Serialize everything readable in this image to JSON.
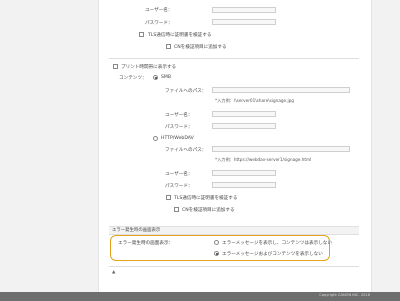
{
  "auth_top": {
    "username_label": "ユーザー名：",
    "password_label": "パスワード：",
    "tls_verify_label": "TLS通信時に証明書を検証する",
    "cn_add_label": "CNを検証項目に追加する"
  },
  "print_job_section": {
    "title": "プリント時間帯に表示する",
    "content_label": "コンテンツ：",
    "smb_label": "SMB",
    "file_path_label": "ファイルへのパス：",
    "smb_example": "*入力例：\\\\server01\\share\\signage.jpg",
    "username_label": "ユーザー名：",
    "password_label": "パスワード：",
    "http_label": "HTTP/WebDAV",
    "http_file_path_label": "ファイルへのパス：",
    "http_example": "*入力例：https://webdav-server1/signage.html",
    "http_username_label": "ユーザー名：",
    "http_password_label": "パスワード：",
    "tls_verify_label": "TLS通信時に証明書を検証する",
    "cn_add_label": "CNを検証項目に追加する"
  },
  "error_section": {
    "title": "エラー発生時の画面表示",
    "setting_label": "エラー発生時の画面表示：",
    "option1": "エラーメッセージを表示し、コンテンツは表示しない",
    "option2": "エラーメッセージおよびコンテンツを表示しない",
    "selected": "option2"
  },
  "back_to_top": "▲",
  "footer": "Copyright CANON INC. 2018"
}
